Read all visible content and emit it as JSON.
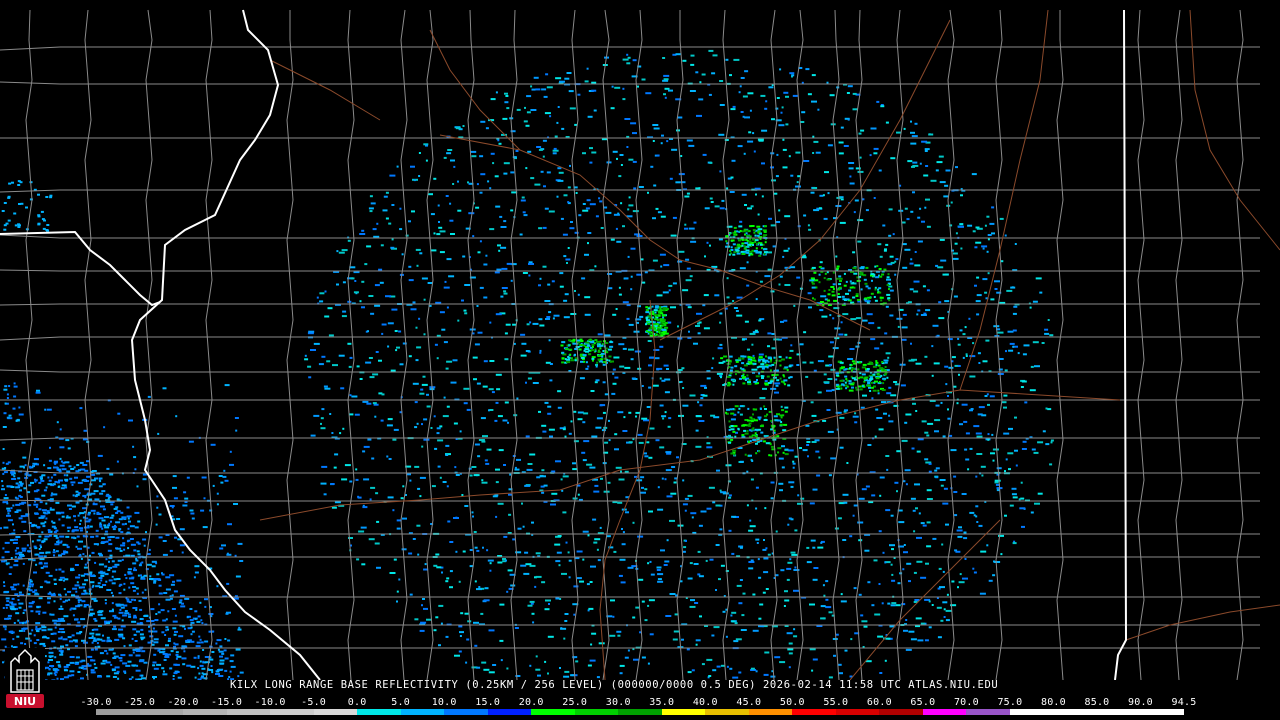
{
  "product": {
    "caption": "KILX LONG RANGE BASE REFLECTIVITY (0.25KM / 256 LEVEL) (000000/0000 0.5 DEG) 2026-02-14 11:58 UTC  ATLAS.NIU.EDU"
  },
  "legend": {
    "ticks": [
      "-30.0",
      "-25.0",
      "-20.0",
      "-15.0",
      "-10.0",
      "-5.0",
      "0.0",
      "5.0",
      "10.0",
      "15.0",
      "20.0",
      "25.0",
      "30.0",
      "35.0",
      "40.0",
      "45.0",
      "50.0",
      "55.0",
      "60.0",
      "65.0",
      "70.0",
      "75.0",
      "80.0",
      "85.0",
      "90.0",
      "94.5"
    ],
    "colors": [
      "#9c9c9c",
      "#a8a8a8",
      "#b4b4b4",
      "#c0c0c0",
      "#cccccc",
      "#d8d8d8",
      "#00e8e8",
      "#00b4ff",
      "#0078ff",
      "#0020ff",
      "#00ff00",
      "#00d000",
      "#00a000",
      "#ffff00",
      "#e8c000",
      "#ff9000",
      "#ff0000",
      "#d80000",
      "#b00000",
      "#ff00ff",
      "#9955c8",
      "#ffffff",
      "#ffffff",
      "#ffffff",
      "#ffffff"
    ]
  },
  "logo": {
    "text": "NIU",
    "color": "#c8102e"
  },
  "map_style": {
    "state_border_color": "#ffffff",
    "county_line_color": "#8a8a8a",
    "road_color": "#8b4a2b"
  }
}
